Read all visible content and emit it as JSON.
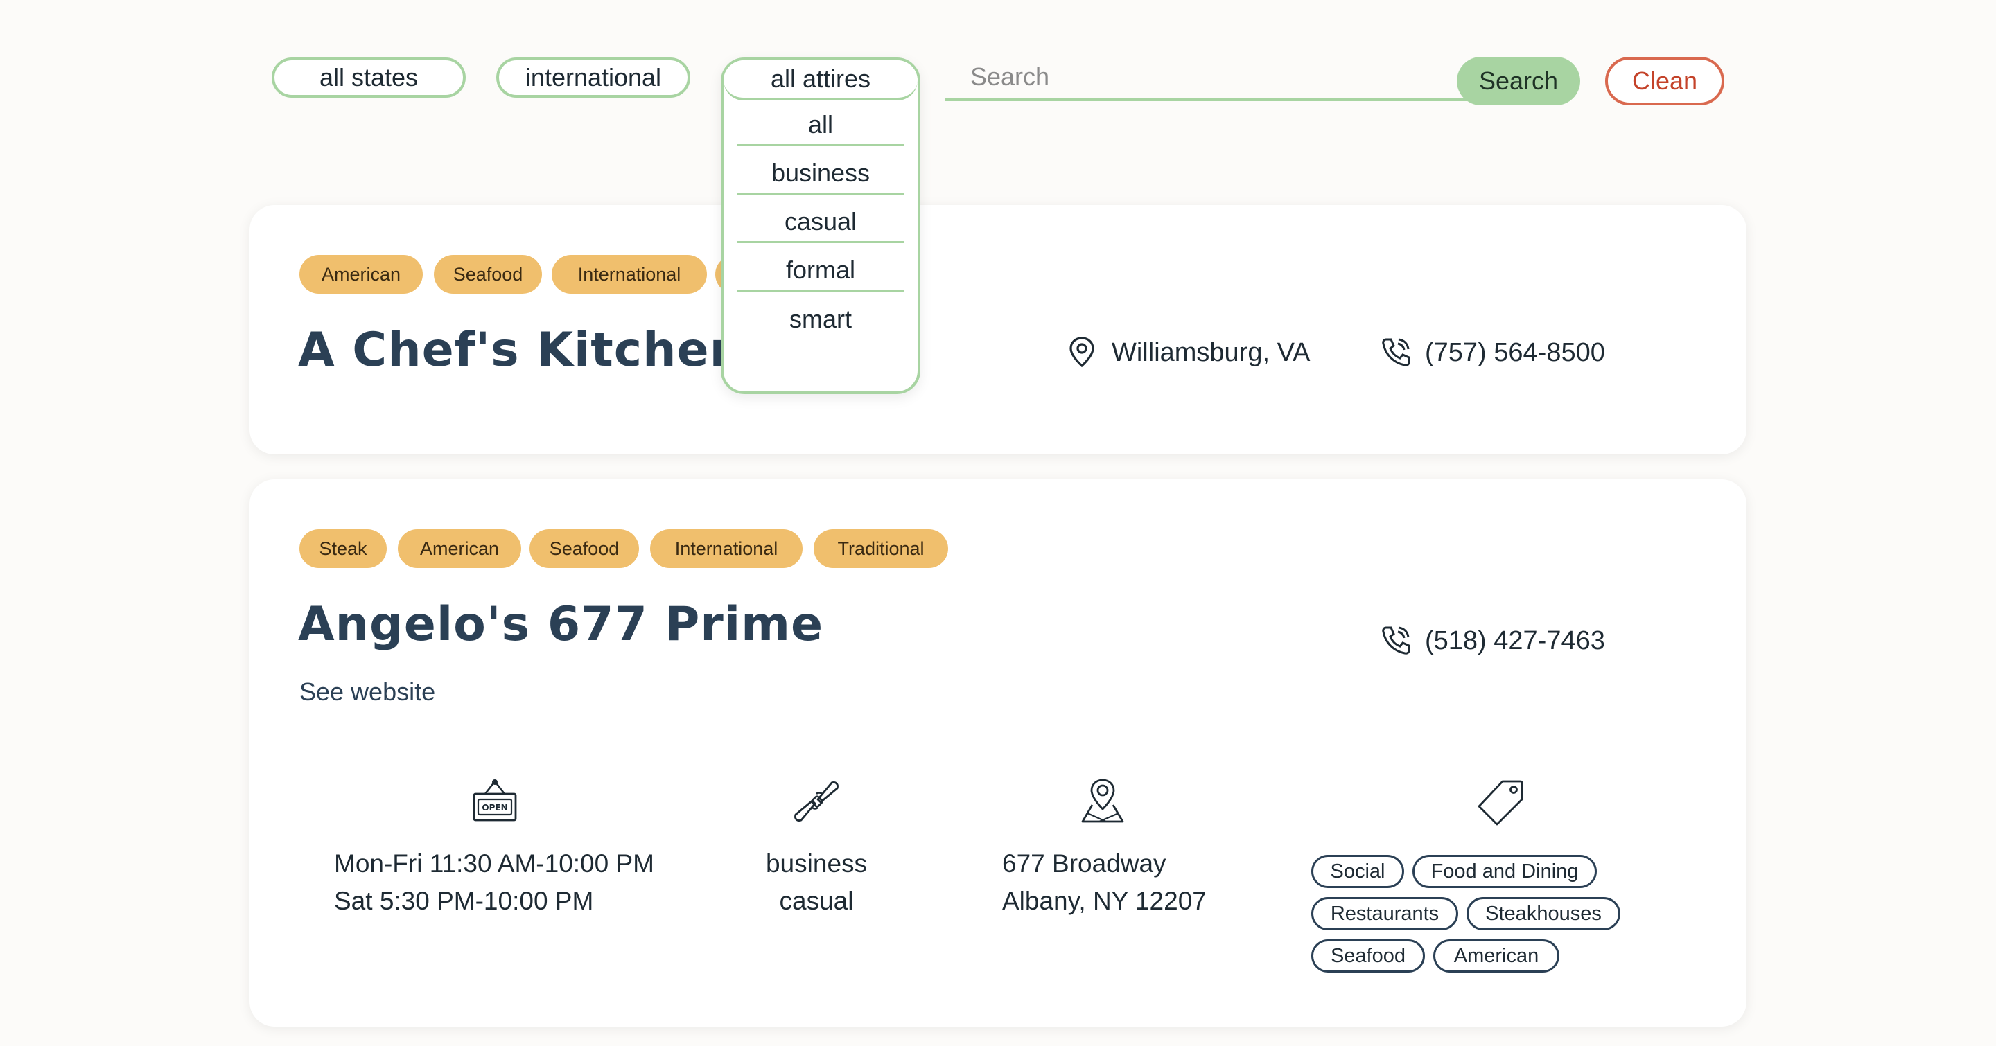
{
  "filters": {
    "state": "all states",
    "cuisine": "international",
    "attire": "all attires",
    "attire_options": [
      "all",
      "business",
      "casual",
      "formal",
      "smart"
    ],
    "search_placeholder": "Search",
    "search_label": "Search",
    "clean_label": "Clean"
  },
  "restaurants": [
    {
      "tags": [
        "American",
        "Seafood",
        "International"
      ],
      "name": "A Chef's Kitchen",
      "location": "Williamsburg, VA",
      "phone": "(757) 564-8500"
    },
    {
      "tags": [
        "Steak",
        "American",
        "Seafood",
        "International",
        "Traditional"
      ],
      "name": "Angelo's 677 Prime",
      "website_label": "See website",
      "phone": "(518) 427-7463",
      "hours": [
        "Mon-Fri 11:30 AM-10:00 PM",
        "Sat 5:30 PM-10:00 PM"
      ],
      "attire": [
        "business",
        "casual"
      ],
      "address": [
        "677 Broadway",
        "Albany, NY 12207"
      ],
      "categories": [
        "Social",
        "Food and Dining",
        "Restaurants",
        "Steakhouses",
        "Seafood",
        "American"
      ]
    }
  ],
  "colors": {
    "accent_green": "#a8d4a2",
    "tag_yellow": "#f0bf6d",
    "clean_red": "#d9694f",
    "title_navy": "#2b4055"
  }
}
